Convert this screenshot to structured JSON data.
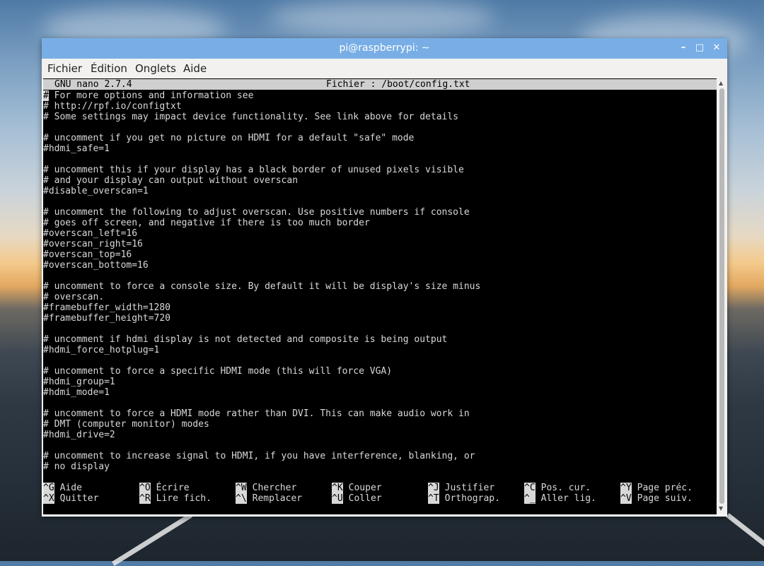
{
  "window": {
    "title": "pi@raspberrypi: ~",
    "controls": {
      "minimize": "–",
      "maximize": "□",
      "close": "✕"
    }
  },
  "menubar": {
    "items": [
      "Fichier",
      "Édition",
      "Onglets",
      "Aide"
    ]
  },
  "nano": {
    "version": "GNU nano 2.7.4",
    "file_label": "Fichier : /boot/config.txt"
  },
  "file_lines": [
    "# For more options and information see",
    "# http://rpf.io/configtxt",
    "# Some settings may impact device functionality. See link above for details",
    "",
    "# uncomment if you get no picture on HDMI for a default \"safe\" mode",
    "#hdmi_safe=1",
    "",
    "# uncomment this if your display has a black border of unused pixels visible",
    "# and your display can output without overscan",
    "#disable_overscan=1",
    "",
    "# uncomment the following to adjust overscan. Use positive numbers if console",
    "# goes off screen, and negative if there is too much border",
    "#overscan_left=16",
    "#overscan_right=16",
    "#overscan_top=16",
    "#overscan_bottom=16",
    "",
    "# uncomment to force a console size. By default it will be display's size minus",
    "# overscan.",
    "#framebuffer_width=1280",
    "#framebuffer_height=720",
    "",
    "# uncomment if hdmi display is not detected and composite is being output",
    "#hdmi_force_hotplug=1",
    "",
    "# uncomment to force a specific HDMI mode (this will force VGA)",
    "#hdmi_group=1",
    "#hdmi_mode=1",
    "",
    "# uncomment to force a HDMI mode rather than DVI. This can make audio work in",
    "# DMT (computer monitor) modes",
    "#hdmi_drive=2",
    "",
    "# uncomment to increase signal to HDMI, if you have interference, blanking, or",
    "# no display"
  ],
  "shortcuts": [
    [
      {
        "key": "^G",
        "label": "Aide"
      },
      {
        "key": "^O",
        "label": "Écrire"
      },
      {
        "key": "^W",
        "label": "Chercher"
      },
      {
        "key": "^K",
        "label": "Couper"
      },
      {
        "key": "^J",
        "label": "Justifier"
      },
      {
        "key": "^C",
        "label": "Pos. cur."
      },
      {
        "key": "^Y",
        "label": "Page préc."
      }
    ],
    [
      {
        "key": "^X",
        "label": "Quitter"
      },
      {
        "key": "^R",
        "label": "Lire fich."
      },
      {
        "key": "^\\",
        "label": "Remplacer"
      },
      {
        "key": "^U",
        "label": "Coller"
      },
      {
        "key": "^T",
        "label": "Orthograp."
      },
      {
        "key": "^_",
        "label": "Aller lig."
      },
      {
        "key": "^V",
        "label": "Page suiv."
      }
    ]
  ],
  "colors": {
    "titlebar": "#78aee5",
    "terminal_bg": "#000000",
    "terminal_fg": "#d8d8d8",
    "nano_header_bg": "#cfcfcf"
  }
}
